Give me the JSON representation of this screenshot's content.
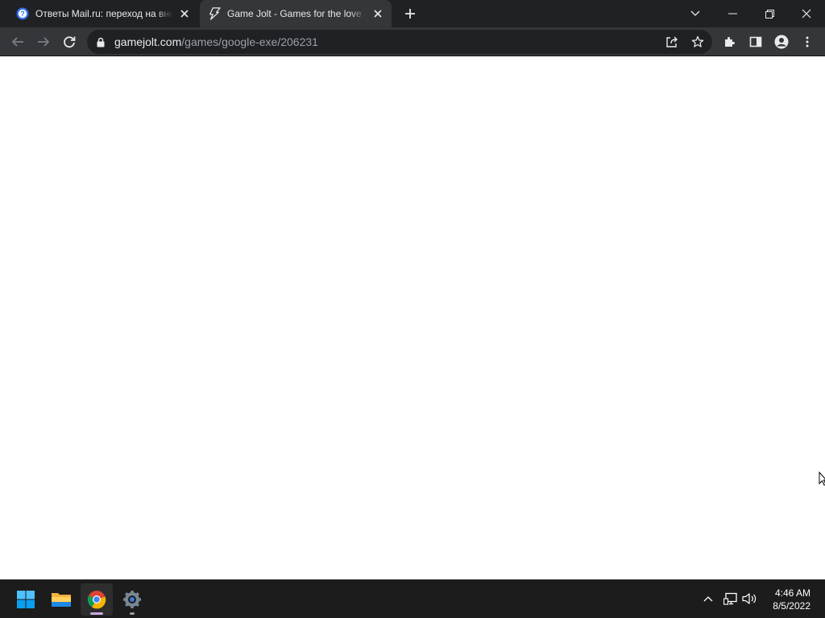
{
  "browser": {
    "tabs": [
      {
        "title": "Ответы Mail.ru: переход на внешний",
        "active": false,
        "favicon": "mail-answers-icon"
      },
      {
        "title": "Game Jolt - Games for the love of it",
        "active": true,
        "favicon": "gamejolt-icon"
      }
    ],
    "address": {
      "host": "gamejolt.com",
      "path": "/games/google-exe/206231"
    }
  },
  "taskbar": {
    "apps": [
      "start-icon",
      "file-explorer-icon",
      "chrome-icon",
      "settings-icon"
    ],
    "clock": {
      "time": "4:46 AM",
      "date": "8/5/2022"
    }
  },
  "colors": {
    "tabstrip": "#202124",
    "toolbar": "#35363a",
    "omnibox": "#202124",
    "page": "#ffffff",
    "taskbar": "#1c1c1c"
  }
}
